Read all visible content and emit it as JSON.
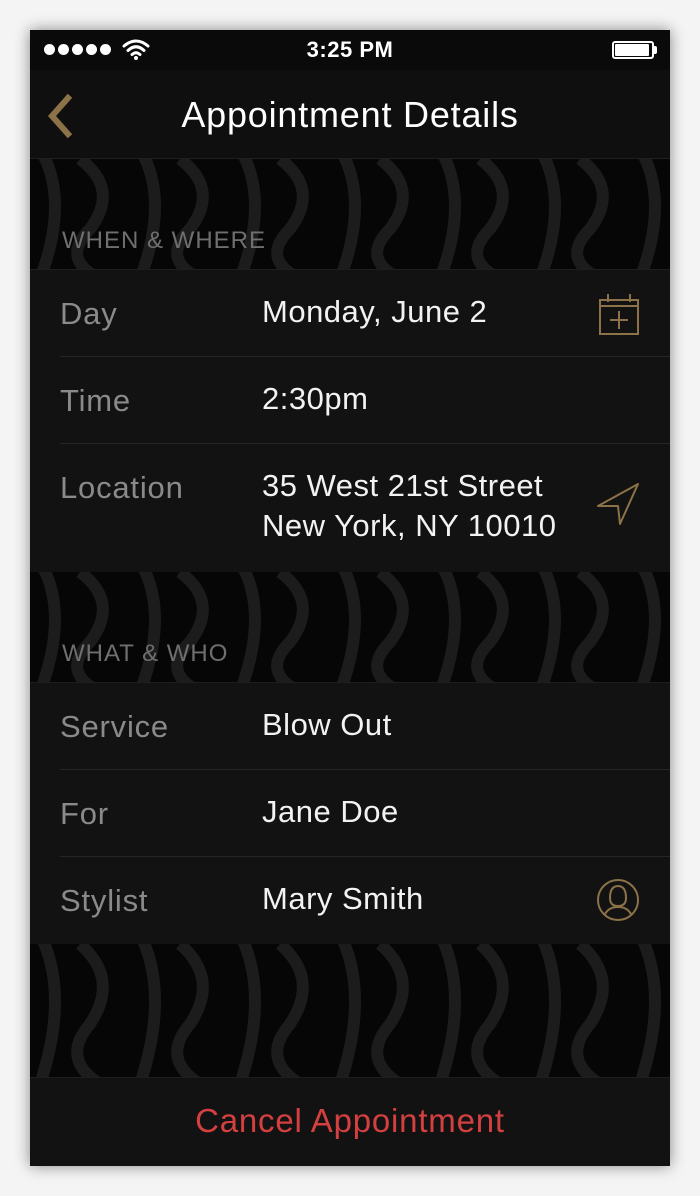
{
  "status_bar": {
    "time": "3:25 PM"
  },
  "nav": {
    "title": "Appointment Details",
    "back_icon": "chevron-left-icon"
  },
  "sections": [
    {
      "header": "WHEN & WHERE",
      "rows": [
        {
          "label": "Day",
          "value": "Monday, June 2",
          "icon": "calendar-add-icon"
        },
        {
          "label": "Time",
          "value": "2:30pm"
        },
        {
          "label": "Location",
          "value_line1": "35 West 21st Street",
          "value_line2": "New York, NY 10010",
          "icon": "navigation-arrow-icon"
        }
      ]
    },
    {
      "header": "WHAT & WHO",
      "rows": [
        {
          "label": "Service",
          "value": "Blow Out"
        },
        {
          "label": "For",
          "value": "Jane Doe"
        },
        {
          "label": "Stylist",
          "value": "Mary Smith",
          "icon": "person-icon"
        }
      ]
    }
  ],
  "footer": {
    "cancel_label": "Cancel Appointment"
  },
  "colors": {
    "accent_gold": "#8c7248",
    "danger_red": "#d3403f",
    "background": "#0a0a0a"
  }
}
